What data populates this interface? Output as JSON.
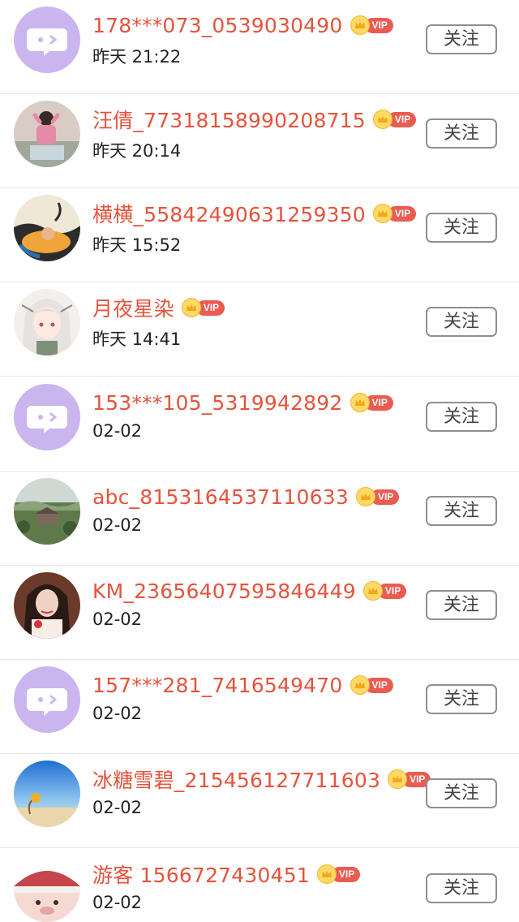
{
  "follow_list": {
    "items": [
      {
        "username": "178***073_0539030490",
        "vip": "VIP",
        "time": "昨天 21:22",
        "follow_label": "关注",
        "avatar": "default-chat-avatar"
      },
      {
        "username": "汪倩_7731815899020871​5",
        "vip": "VIP",
        "time": "昨天 20:14",
        "follow_label": "关注",
        "avatar": "photo-child-avatar"
      },
      {
        "username": "横横_55842490631259350",
        "vip": "VIP",
        "time": "昨天 15:52",
        "follow_label": "关注",
        "avatar": "illustration-pool-avatar"
      },
      {
        "username": "月夜星染",
        "vip": "VIP",
        "time": "昨天 14:41",
        "follow_label": "关注",
        "avatar": "anime-girl-avatar"
      },
      {
        "username": "153***105_5319942892",
        "vip": "VIP",
        "time": "02-02",
        "follow_label": "关注",
        "avatar": "default-chat-avatar"
      },
      {
        "username": "abc_8153164537110633",
        "vip": "VIP",
        "time": "02-02",
        "follow_label": "关注",
        "avatar": "landscape-village-avatar"
      },
      {
        "username": "KM_23656407595846449",
        "vip": "VIP",
        "time": "02-02",
        "follow_label": "关注",
        "avatar": "photo-woman-avatar"
      },
      {
        "username": "157***281_7416549470",
        "vip": "VIP",
        "time": "02-02",
        "follow_label": "关注",
        "avatar": "default-chat-avatar"
      },
      {
        "username": "冰糖雪碧_215456127711603",
        "vip": "VIP",
        "time": "02-02",
        "follow_label": "关注",
        "avatar": "beach-sky-avatar"
      },
      {
        "username": "游客 1566727430451",
        "vip": "VIP",
        "time": "02-02",
        "follow_label": "关注",
        "avatar": "santa-face-avatar"
      }
    ]
  },
  "colors": {
    "username": "#e5533d",
    "vip_badge": "#ea5c52",
    "vip_crown": "#ffd966",
    "default_avatar": "#cbb5ef",
    "divider": "#e6e6e6"
  }
}
